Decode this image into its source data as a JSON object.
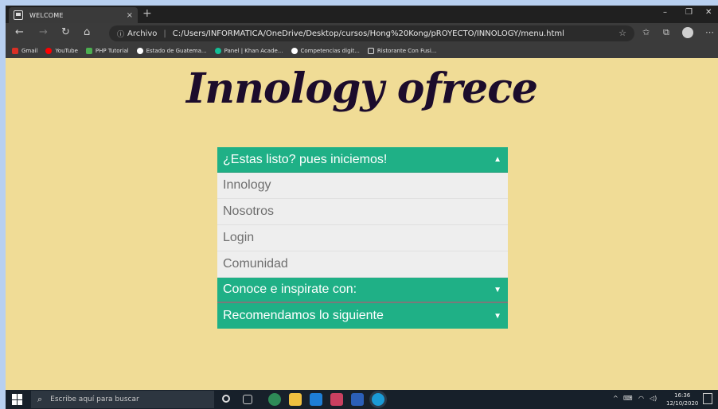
{
  "browser": {
    "tab_title": "WELCOME",
    "tab_close": "×",
    "new_tab": "+",
    "minimize": "–",
    "restore": "❐",
    "close": "✕",
    "url_scheme_label": "Archivo",
    "url_separator": "|",
    "url": "C:/Users/INFORMATICA/OneDrive/Desktop/cursos/Hong%20Kong/pROYECTO/INNOLOGY/menu.html",
    "bookmarks": [
      {
        "label": "Gmail",
        "color": "#d93025"
      },
      {
        "label": "YouTube",
        "color": "#ff0000"
      },
      {
        "label": "PHP Tutorial",
        "color": "#4caf50"
      },
      {
        "label": "Estado de Guatema...",
        "color": "#ffffff"
      },
      {
        "label": "Panel | Khan Acade...",
        "color": "#14bf96"
      },
      {
        "label": "Competencias digit...",
        "color": "#ffffff"
      },
      {
        "label": "Ristorante Con Fusi...",
        "color": "#3b3b3b"
      }
    ]
  },
  "page": {
    "heading": "Innology ofrece",
    "accordion": {
      "section1": {
        "title": "¿Estas listo? pues iniciemos!",
        "arrow": "▲"
      },
      "items": [
        "Innology",
        "Nosotros",
        "Login",
        "Comunidad"
      ],
      "section2": {
        "title": "Conoce e inspirate con:",
        "arrow": "▼"
      },
      "section3": {
        "title": "Recomendamos lo siguiente",
        "arrow": "▼"
      }
    },
    "colors": {
      "background": "#f0dc96",
      "accent": "#1fb086",
      "heading": "#1c0c2c"
    }
  },
  "taskbar": {
    "search_placeholder": "Escribe aquí para buscar",
    "time": "16:36",
    "date": "12/10/2020"
  }
}
